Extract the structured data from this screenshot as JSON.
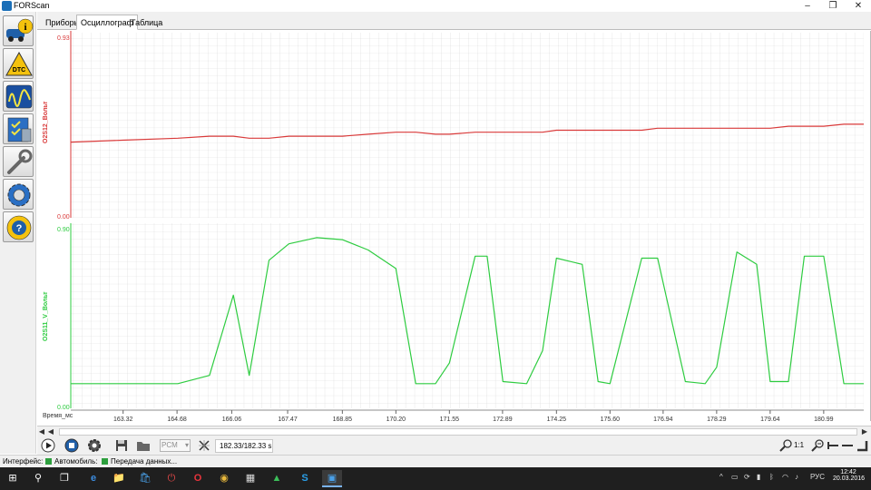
{
  "window": {
    "title": "FORScan",
    "minimize_icon": "‒",
    "maximize_icon": "❐",
    "close_icon": "✕"
  },
  "sidebar": {
    "items": [
      {
        "name": "info",
        "icon": "i"
      },
      {
        "name": "dtc",
        "icon": "DTC"
      },
      {
        "name": "oscilloscope",
        "icon": "∿"
      },
      {
        "name": "checklist",
        "icon": "☑"
      },
      {
        "name": "service",
        "icon": "🔧"
      },
      {
        "name": "configuration",
        "icon": "⚙"
      },
      {
        "name": "help",
        "icon": "?"
      }
    ]
  },
  "tabs": [
    {
      "label": "Приборы"
    },
    {
      "label": "Осциллограф"
    },
    {
      "label": "Таблица"
    }
  ],
  "plot": {
    "top_channel": {
      "label": "O2S12_Вольт",
      "ymax": "0.93",
      "ymin": "0.00",
      "color": "#d93a3a"
    },
    "bottom_channel": {
      "label": "O2S11_V_Вольт",
      "ymax": "0.90",
      "ymin": "0.00",
      "color": "#2ecc40"
    },
    "x_axis_label": "Время_мс",
    "x_ticks": [
      "163.32",
      "164.68",
      "166.06",
      "167.47",
      "168.85",
      "170.20",
      "171.55",
      "172.89",
      "174.25",
      "175.60",
      "176.94",
      "178.29",
      "179.64",
      "180.99"
    ]
  },
  "chart_data": {
    "type": "line",
    "x": [
      162.0,
      163.3,
      164.7,
      165.5,
      166.1,
      166.5,
      167.0,
      167.5,
      168.2,
      168.85,
      169.5,
      170.2,
      170.7,
      171.2,
      171.55,
      172.2,
      172.5,
      172.9,
      173.5,
      173.9,
      174.25,
      174.9,
      175.3,
      175.6,
      176.4,
      176.8,
      177.5,
      178.0,
      178.29,
      178.8,
      179.3,
      179.64,
      180.1,
      180.5,
      180.99,
      181.5,
      182.0
    ],
    "series": [
      {
        "name": "O2S12_Вольт",
        "color": "#d93a3a",
        "values": [
          0.38,
          0.39,
          0.4,
          0.41,
          0.41,
          0.4,
          0.4,
          0.41,
          0.41,
          0.41,
          0.42,
          0.43,
          0.43,
          0.42,
          0.42,
          0.43,
          0.43,
          0.43,
          0.43,
          0.43,
          0.44,
          0.44,
          0.44,
          0.44,
          0.44,
          0.45,
          0.45,
          0.45,
          0.45,
          0.45,
          0.45,
          0.45,
          0.46,
          0.46,
          0.46,
          0.47,
          0.47
        ]
      },
      {
        "name": "O2S11_V_Вольт",
        "color": "#2ecc40",
        "values": [
          0.12,
          0.12,
          0.12,
          0.16,
          0.55,
          0.16,
          0.72,
          0.8,
          0.83,
          0.82,
          0.77,
          0.68,
          0.12,
          0.12,
          0.22,
          0.74,
          0.74,
          0.13,
          0.12,
          0.28,
          0.73,
          0.7,
          0.13,
          0.12,
          0.73,
          0.73,
          0.13,
          0.12,
          0.2,
          0.76,
          0.7,
          0.13,
          0.13,
          0.74,
          0.74,
          0.12,
          0.12
        ]
      }
    ],
    "ylim_top": [
      0.0,
      0.93
    ],
    "ylim_bottom": [
      0.0,
      0.9
    ],
    "xlabel": "Время_мс",
    "grid": true
  },
  "toolbar": {
    "play_icon": "▶",
    "stop_icon": "■",
    "settings_icon": "⚙",
    "save_icon": "💾",
    "open_icon": "📂",
    "ecu_value": "PCM",
    "reset_icon": "⊠",
    "time_display": "182.33/182.33 s",
    "zoom_in_icon": "🔍",
    "zoom_ratio": "1:1",
    "zoom_out_icon": "🔍"
  },
  "statusbar": {
    "interface_label": "Интерфейс:",
    "vehicle_label": "Автомобиль:",
    "transfer_label": "Передача данных..."
  },
  "taskbar": {
    "start_icon": "⊞",
    "search_icon": "⚲",
    "taskview_icon": "❐",
    "apps": [
      "e",
      "📁",
      "🛍",
      "⏻",
      "O",
      "◉",
      "▦",
      "▲",
      "S",
      "▣"
    ],
    "tray_arrow": "^",
    "language": "РУС",
    "time": "12:42",
    "date": "20.03.2016"
  }
}
